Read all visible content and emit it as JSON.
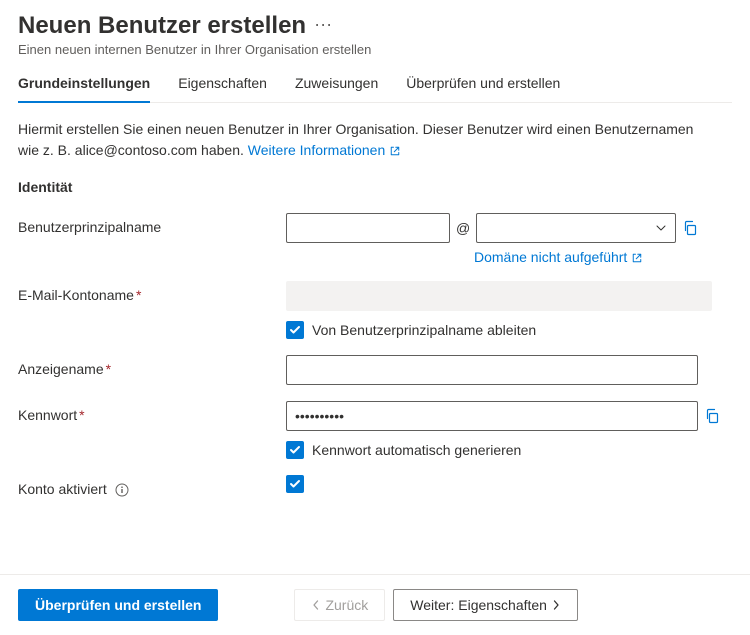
{
  "header": {
    "title": "Neuen Benutzer erstellen",
    "subtitle": "Einen neuen internen Benutzer in Ihrer Organisation erstellen"
  },
  "tabs": {
    "basics": "Grundeinstellungen",
    "properties": "Eigenschaften",
    "assignments": "Zuweisungen",
    "review": "Überprüfen und erstellen"
  },
  "intro": {
    "text": "Hiermit erstellen Sie einen neuen Benutzer in Ihrer Organisation. Dieser Benutzer wird einen Benutzernamen wie z. B. alice@contoso.com haben. ",
    "link": "Weitere Informationen"
  },
  "identity": {
    "section_title": "Identität",
    "upn": {
      "label": "Benutzerprinzipalname",
      "at": "@",
      "domain_not_listed": "Domäne nicht aufgeführt"
    },
    "mail_nickname": {
      "label": "E-Mail-Kontoname",
      "derive_label": "Von Benutzerprinzipalname ableiten"
    },
    "display_name": {
      "label": "Anzeigename"
    },
    "password": {
      "label": "Kennwort",
      "value": "••••••••••",
      "autogen_label": "Kennwort automatisch generieren"
    },
    "account_enabled": {
      "label": "Konto aktiviert"
    }
  },
  "footer": {
    "review": "Überprüfen und erstellen",
    "back": "Zurück",
    "next": "Weiter: Eigenschaften"
  }
}
